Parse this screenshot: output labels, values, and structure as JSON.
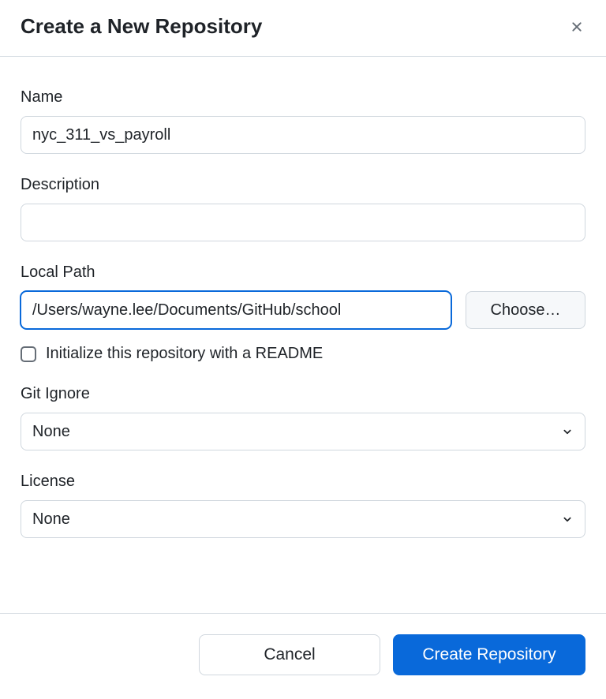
{
  "dialog": {
    "title": "Create a New Repository"
  },
  "fields": {
    "name": {
      "label": "Name",
      "value": "nyc_311_vs_payroll"
    },
    "description": {
      "label": "Description",
      "value": ""
    },
    "local_path": {
      "label": "Local Path",
      "value": "/Users/wayne.lee/Documents/GitHub/school",
      "choose_label": "Choose…"
    },
    "readme": {
      "label": "Initialize this repository with a README",
      "checked": false
    },
    "git_ignore": {
      "label": "Git Ignore",
      "value": "None"
    },
    "license": {
      "label": "License",
      "value": "None"
    }
  },
  "footer": {
    "cancel": "Cancel",
    "create": "Create Repository"
  }
}
